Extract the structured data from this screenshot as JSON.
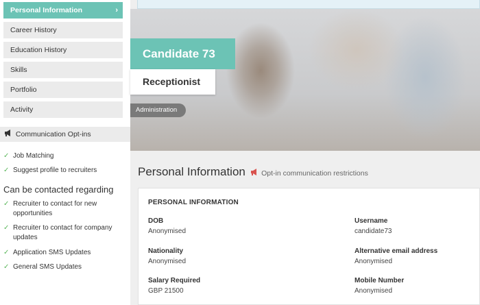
{
  "sidebar": {
    "nav": [
      {
        "label": "Personal Information",
        "active": true
      },
      {
        "label": "Career History",
        "active": false
      },
      {
        "label": "Education History",
        "active": false
      },
      {
        "label": "Skills",
        "active": false
      },
      {
        "label": "Portfolio",
        "active": false
      },
      {
        "label": "Activity",
        "active": false
      }
    ],
    "optins_title": "Communication Opt-ins",
    "optins": [
      "Job Matching",
      "Suggest profile to recruiters"
    ],
    "contact_heading": "Can be contacted regarding",
    "contact": [
      "Recruiter to contact for new opportunities",
      "Recruiter to contact for company updates",
      "Application SMS Updates",
      "General SMS Updates"
    ]
  },
  "hero": {
    "name": "Candidate 73",
    "role": "Receptionist",
    "tag": "Administration"
  },
  "section": {
    "title": "Personal Information",
    "restriction": "Opt-in communication restrictions"
  },
  "card": {
    "heading": "PERSONAL INFORMATION",
    "fields": [
      {
        "label": "DOB",
        "value": "Anonymised"
      },
      {
        "label": "Username",
        "value": "candidate73"
      },
      {
        "label": "Nationality",
        "value": "Anonymised"
      },
      {
        "label": "Alternative email address",
        "value": "Anonymised"
      },
      {
        "label": "Salary Required",
        "value": "GBP 21500"
      },
      {
        "label": "Mobile Number",
        "value": "Anonymised"
      }
    ]
  },
  "colors": {
    "accent": "#6cc3b5",
    "check": "#5bb75b",
    "megaphone_red": "#d9534f"
  },
  "icons": {
    "active_nav": "chevron-right-icon",
    "optins": "megaphone-icon",
    "check": "check-icon"
  }
}
